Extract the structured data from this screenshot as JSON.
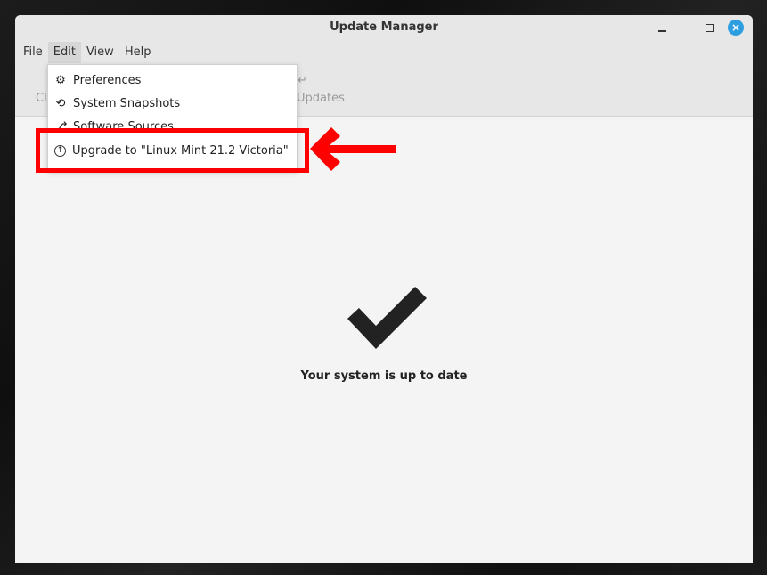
{
  "window": {
    "title": "Update Manager"
  },
  "window_controls": {
    "minimize": "minimize",
    "maximize": "maximize",
    "close": "×"
  },
  "menubar": {
    "items": [
      "File",
      "Edit",
      "View",
      "Help"
    ],
    "active": "Edit"
  },
  "toolbar": {
    "partial_left": "Cl",
    "partial_right": "Updates",
    "return_glyph": "↵"
  },
  "edit_menu": {
    "items": [
      {
        "label": "Preferences",
        "icon": "gear-icon",
        "glyph": "⚙"
      },
      {
        "label": "System Snapshots",
        "icon": "history-icon",
        "glyph": "⟲"
      },
      {
        "label": "Software Sources",
        "icon": "software-sources-icon",
        "glyph": "⎇"
      },
      {
        "label": "Upgrade to \"Linux Mint 21.2 Victoria\"",
        "icon": "upgrade-arrow-icon",
        "glyph": "↑"
      }
    ]
  },
  "content": {
    "status_message": "Your system is up to date",
    "status_icon": "checkmark-icon"
  },
  "annotation": {
    "highlight_color": "#ff0000",
    "highlighted_item": "Upgrade to \"Linux Mint 21.2 Victoria\""
  },
  "colors": {
    "accent_close": "#2d9ee0"
  }
}
